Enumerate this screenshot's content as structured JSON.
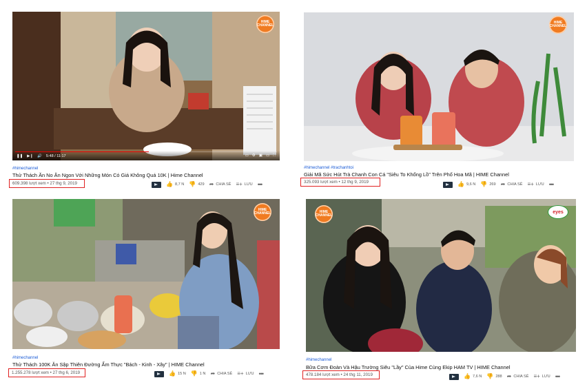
{
  "videos": [
    {
      "hashtag": "#himechannel",
      "title": "Thử Thách Ăn No Ăn Ngon Với Những Món Có Giá Không Quá 10K | Hime Channel",
      "meta": "609.398 lượt xem • 27 thg 9, 2019",
      "likes": "8,7 N",
      "dislikes": "429",
      "share": "CHIA SẺ",
      "save": "LƯU",
      "badge": "HIME CHANNEL",
      "player_time": "5:48 / 11:17",
      "progress_fraction": 0.51
    },
    {
      "hashtag": "#himechannel #trachanhtoi",
      "title": "Giải Mã Sức Hút Trà Chanh Con Cá \"Siêu To Khổng Lồ\" Trên Phố Hoa Mã | HIME Channel",
      "meta": "325.093 lượt xem • 12 thg 9, 2019",
      "likes": "9,6 N",
      "dislikes": "269",
      "share": "CHIA SẺ",
      "save": "LƯU",
      "badge": "HIME CHANNEL"
    },
    {
      "hashtag": "#himechannel",
      "title": "Thử Thách 100K Ăn Sập Thiên Đường Ẩm Thực \"Bách - Kinh - Xây\" | HIME Channel",
      "meta": "1.255.278 lượt xem • 27 thg 6, 2019",
      "likes": "15 N",
      "dislikes": "1 N",
      "share": "CHIA SẺ",
      "save": "LƯU",
      "badge": "HIME CHANNEL"
    },
    {
      "hashtag": "#himechannel",
      "title": "Bữa Cơm Đoàn Và Hậu Trường Siêu \"Lầy\" Của Hime Cùng Ekip HAM TV | HIME Channel",
      "meta": "478.184 lượt xem • 24 thg 11, 2019",
      "likes": "7,6 N",
      "dislikes": "288",
      "share": "CHIA SẺ",
      "save": "LƯU",
      "badge": "HIME CHANNEL",
      "badge2": "eyes"
    }
  ],
  "colors": {
    "highlight": "#e02020",
    "hashtag": "#1a5bd6",
    "badge": "#f07b21"
  }
}
